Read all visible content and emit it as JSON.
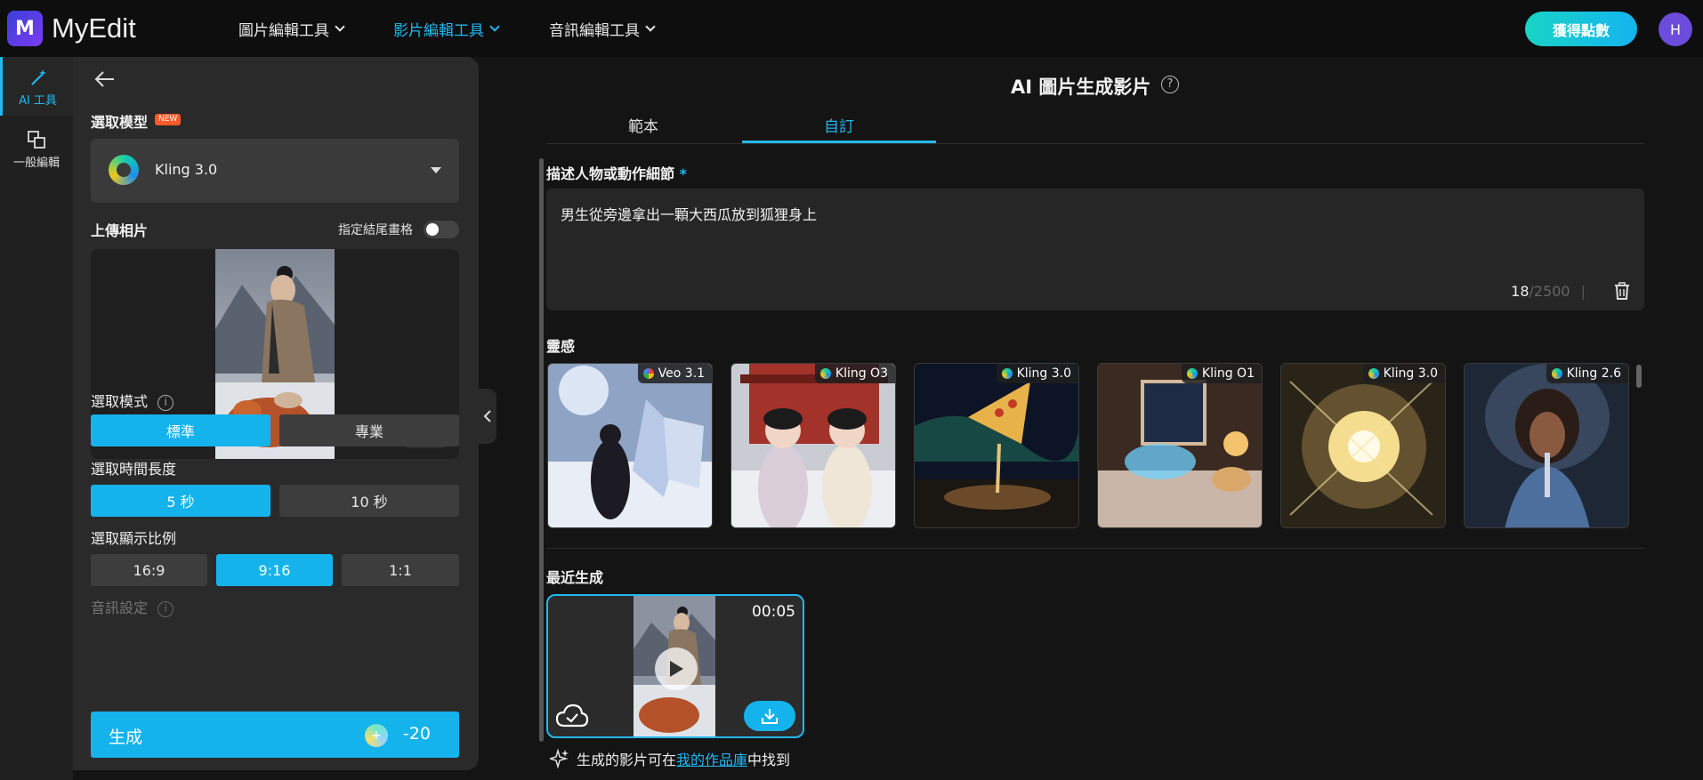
{
  "app": {
    "brand": "MyEdit",
    "logo_letter": "M"
  },
  "nav": {
    "items": [
      {
        "label": "圖片編輯工具",
        "active": false
      },
      {
        "label": "影片編輯工具",
        "active": true
      },
      {
        "label": "音訊編輯工具",
        "active": false
      }
    ],
    "get_points": "獲得點數",
    "avatar": "H"
  },
  "rail": {
    "items": [
      {
        "label": "AI 工具",
        "icon": "magic-wand-icon",
        "active": true
      },
      {
        "label": "一般編輯",
        "icon": "layers-icon",
        "active": false
      }
    ]
  },
  "panel": {
    "model_label": "選取模型",
    "new_badge": "NEW",
    "model_name": "Kling 3.0",
    "upload_label": "上傳相片",
    "end_frame_label": "指定結尾畫格",
    "mode_label": "選取模式",
    "modes": [
      "標準",
      "專業"
    ],
    "duration_label": "選取時間長度",
    "durations": [
      "5 秒",
      "10 秒"
    ],
    "ratio_label": "選取顯示比例",
    "ratios": [
      "16:9",
      "9:16",
      "1:1"
    ],
    "audio_label": "音訊設定",
    "generate_label": "生成",
    "generate_cost": "-20"
  },
  "main": {
    "title": "AI 圖片生成影片",
    "tabs": [
      {
        "label": "範本",
        "active": false
      },
      {
        "label": "自訂",
        "active": true
      }
    ],
    "prompt_label": "描述人物或動作細節",
    "prompt_required": "*",
    "prompt_text": "男生從旁邊拿出一顆大西瓜放到狐狸身上",
    "char_count": "18",
    "char_max": "/2500",
    "char_sep": "|",
    "inspiration_label": "靈感",
    "inspiration": [
      {
        "model": "Veo 3.1"
      },
      {
        "model": "Kling O3"
      },
      {
        "model": "Kling 3.0"
      },
      {
        "model": "Kling O1"
      },
      {
        "model": "Kling 3.0"
      },
      {
        "model": "Kling 2.6"
      }
    ],
    "recent_label": "最近生成",
    "recent": {
      "duration": "00:05"
    },
    "footnote_prefix": "生成的影片可在",
    "footnote_link": "我的作品庫",
    "footnote_suffix": "中找到"
  },
  "colors": {
    "accent": "#15b3ec",
    "background": "#141414",
    "panel": "#2a2a2a"
  }
}
